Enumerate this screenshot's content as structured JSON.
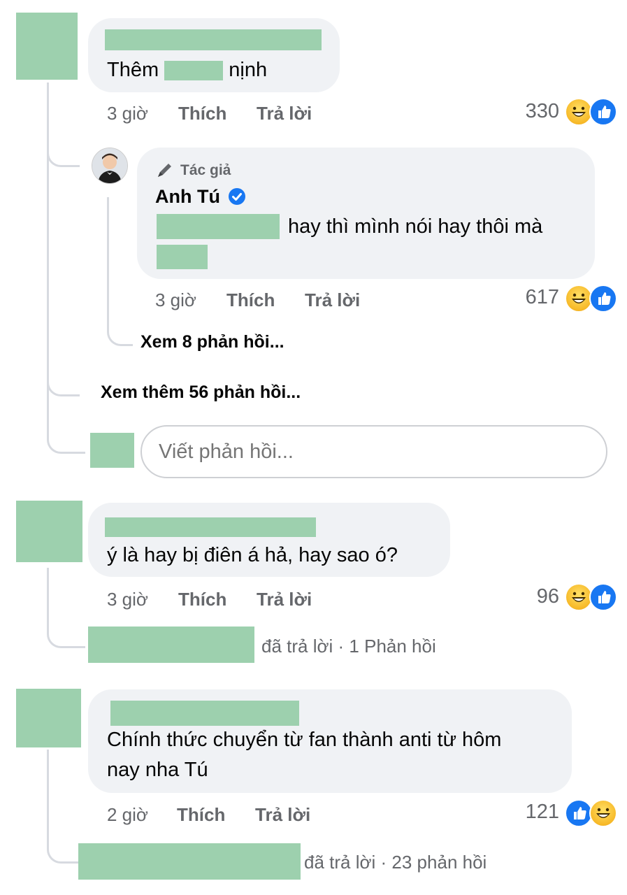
{
  "comment1": {
    "text_visible": "Thêm",
    "text_visible_end": "nịnh",
    "time": "3 giờ",
    "like_label": "Thích",
    "reply_label": "Trả lời",
    "reaction_count": "330",
    "reactions": [
      "haha-icon",
      "like-icon"
    ]
  },
  "author_reply": {
    "badge": "Tác giả",
    "name": "Anh Tú",
    "text": "hay thì mình nói hay thôi mà",
    "time": "3 giờ",
    "like_label": "Thích",
    "reply_label": "Trả lời",
    "reaction_count": "617",
    "view_replies": "Xem 8 phản hồi..."
  },
  "view_more": "Xem thêm 56 phản hồi...",
  "reply_input": {
    "placeholder": "Viết phản hồi..."
  },
  "comment2": {
    "text": "ý là hay bị điên á hả, hay sao ó?",
    "time": "3 giờ",
    "like_label": "Thích",
    "reply_label": "Trả lời",
    "reaction_count": "96",
    "replied_text": "đã trả lời · 1 Phản hồi"
  },
  "comment3": {
    "text_line1": "Chính thức chuyển từ fan thành anti từ hôm",
    "text_line2": "nay nha Tú",
    "time": "2 giờ",
    "like_label": "Thích",
    "reply_label": "Trả lời",
    "reaction_count": "121",
    "replied_text": "đã trả lời · 23 phản hồi"
  },
  "colors": {
    "like_blue": "#1877f2",
    "verified_blue": "#1877f2",
    "redaction": "#9dd0ae"
  }
}
